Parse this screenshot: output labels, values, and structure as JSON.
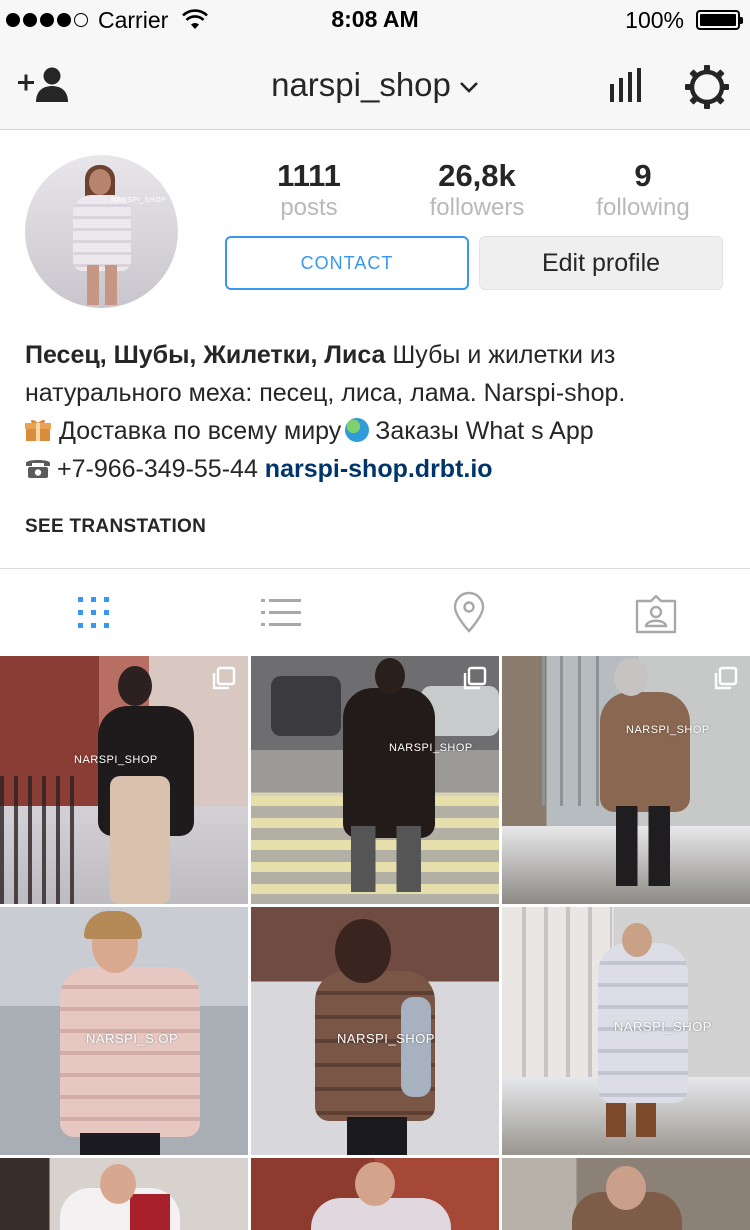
{
  "status_bar": {
    "carrier": "Carrier",
    "time": "8:08 AM",
    "battery": "100%",
    "signal_bars_filled": 4,
    "signal_bars_total": 5,
    "battery_level": 1.0
  },
  "nav": {
    "username": "narspi_shop",
    "icons": [
      "add-person-icon",
      "chevron-down-icon",
      "stats-icon",
      "gear-icon"
    ]
  },
  "profile": {
    "avatar_watermark": "NARSPI_SHOP",
    "stats": [
      {
        "value": "1111",
        "label": "posts"
      },
      {
        "value": "26,8k",
        "label": "followers"
      },
      {
        "value": "9",
        "label": "following"
      }
    ],
    "contact_label": "CONTACT",
    "edit_label": "Edit profile"
  },
  "bio": {
    "name": "Песец, Шубы, Жилетки, Лиса",
    "line1_rest": " Шубы и жилетки из",
    "line2": "натурального меха: песец, лиса, лама. Narspi-shop.",
    "line3_a": "Доставка по всему миру",
    "line3_b": "Заказы What s App",
    "line4_phone": "+7-966-349-55-44",
    "line4_link": "narspi-shop.drbt.io",
    "see_translation": "SEE TRANSTATION"
  },
  "tabs": [
    {
      "icon": "grid-icon",
      "active": true
    },
    {
      "icon": "list-icon",
      "active": false
    },
    {
      "icon": "location-pin-icon",
      "active": false
    },
    {
      "icon": "tagged-person-icon",
      "active": false
    }
  ],
  "colors": {
    "accent_blue": "#3897f0",
    "link_blue": "#003569",
    "muted_gray": "#b9b9b9",
    "bar_bg": "#f7f7f7"
  },
  "grid": {
    "watermark": "NARSPI_SHOP",
    "watermark_alt": "NARSPI_S.OP"
  }
}
